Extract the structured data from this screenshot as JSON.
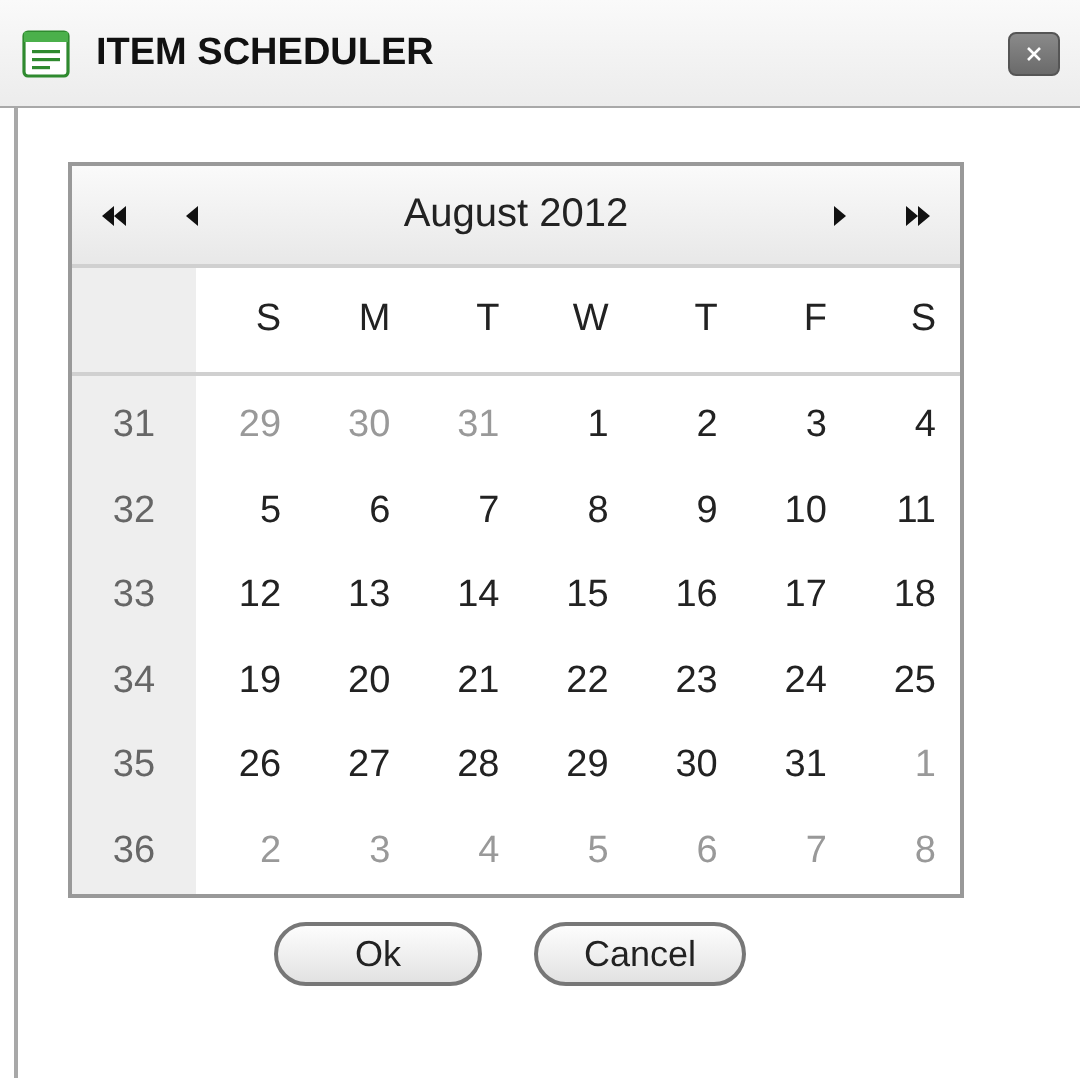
{
  "window": {
    "title": "ITEM SCHEDULER"
  },
  "calendar": {
    "nav": [
      {
        "kind": "prev-year"
      },
      {
        "kind": "prev-month"
      },
      {
        "kind": "next-month"
      },
      {
        "kind": "next-year"
      }
    ],
    "title": "August 2012",
    "weekdays": [
      "S",
      "M",
      "T",
      "W",
      "T",
      "F",
      "S"
    ],
    "weeks": [
      {
        "number": "31",
        "days": [
          {
            "day": "29",
            "muted": true
          },
          {
            "day": "30",
            "muted": true
          },
          {
            "day": "31",
            "muted": true
          },
          {
            "day": "1",
            "muted": false
          },
          {
            "day": "2",
            "muted": false
          },
          {
            "day": "3",
            "muted": false
          },
          {
            "day": "4",
            "muted": false
          }
        ]
      },
      {
        "number": "32",
        "days": [
          {
            "day": "5",
            "muted": false
          },
          {
            "day": "6",
            "muted": false
          },
          {
            "day": "7",
            "muted": false
          },
          {
            "day": "8",
            "muted": false
          },
          {
            "day": "9",
            "muted": false
          },
          {
            "day": "10",
            "muted": false
          },
          {
            "day": "11",
            "muted": false
          }
        ]
      },
      {
        "number": "33",
        "days": [
          {
            "day": "12",
            "muted": false
          },
          {
            "day": "13",
            "muted": false
          },
          {
            "day": "14",
            "muted": false
          },
          {
            "day": "15",
            "muted": false
          },
          {
            "day": "16",
            "muted": false
          },
          {
            "day": "17",
            "muted": false
          },
          {
            "day": "18",
            "muted": false
          }
        ]
      },
      {
        "number": "34",
        "days": [
          {
            "day": "19",
            "muted": false
          },
          {
            "day": "20",
            "muted": false
          },
          {
            "day": "21",
            "muted": false
          },
          {
            "day": "22",
            "muted": false
          },
          {
            "day": "23",
            "muted": false
          },
          {
            "day": "24",
            "muted": false
          },
          {
            "day": "25",
            "muted": false
          }
        ]
      },
      {
        "number": "35",
        "days": [
          {
            "day": "26",
            "muted": false
          },
          {
            "day": "27",
            "muted": false
          },
          {
            "day": "28",
            "muted": false
          },
          {
            "day": "29",
            "muted": false
          },
          {
            "day": "30",
            "muted": false
          },
          {
            "day": "31",
            "muted": false
          },
          {
            "day": "1",
            "muted": true
          }
        ]
      },
      {
        "number": "36",
        "days": [
          {
            "day": "2",
            "muted": true
          },
          {
            "day": "3",
            "muted": true
          },
          {
            "day": "4",
            "muted": true
          },
          {
            "day": "5",
            "muted": true
          },
          {
            "day": "6",
            "muted": true
          },
          {
            "day": "7",
            "muted": true
          },
          {
            "day": "8",
            "muted": true
          }
        ]
      }
    ]
  },
  "buttons": [
    "Ok",
    "Cancel"
  ]
}
